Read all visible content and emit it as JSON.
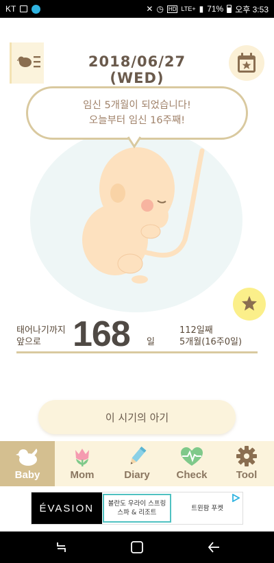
{
  "status_bar": {
    "carrier": "KT",
    "network": "LTE+",
    "battery": "71%",
    "time": "오후 3:53"
  },
  "header": {
    "date": "2018/06/27 (WED)"
  },
  "bubble": {
    "line1": "임신 5개월이 되었습니다!",
    "line2": "오늘부터 임신 16주째!"
  },
  "countdown": {
    "label_line1": "태어나기까지",
    "label_line2": "앞으로",
    "number": "168",
    "unit": "일",
    "days_elapsed": "112일째",
    "week_info": "5개월(16주0일)"
  },
  "period_button": {
    "label": "이 시기의 아기"
  },
  "nav": {
    "items": [
      {
        "label": "Baby",
        "icon": "bird-icon",
        "active": true
      },
      {
        "label": "Mom",
        "icon": "tulip-icon",
        "active": false
      },
      {
        "label": "Diary",
        "icon": "pencil-icon",
        "active": false
      },
      {
        "label": "Check",
        "icon": "heartbeat-icon",
        "active": false
      },
      {
        "label": "Tool",
        "icon": "gear-icon",
        "active": false
      }
    ]
  },
  "ad": {
    "brand": "ÉVASION",
    "option1_line1": "볼란도 우라이 스프링",
    "option1_line2": "스파 & 리조트",
    "option2": "트윈팜 푸켓"
  },
  "colors": {
    "accent_gold": "#d9c99f",
    "nav_active": "#d4bf90",
    "cream": "#fbf3dc",
    "text_brown": "#6a5a4c"
  }
}
